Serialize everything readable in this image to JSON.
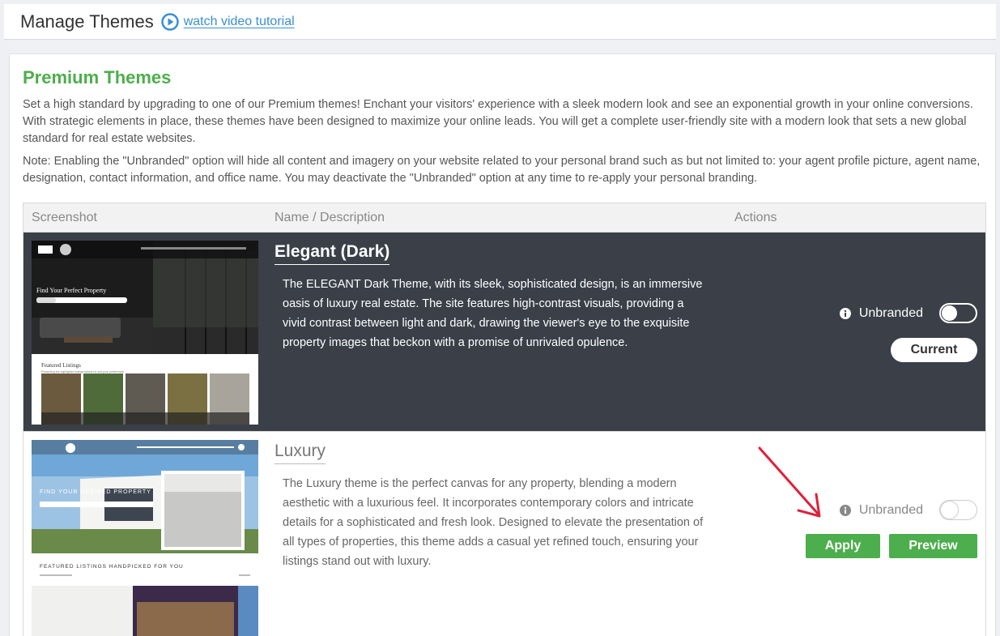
{
  "header": {
    "title": "Manage Themes",
    "tutorial_link": "watch video tutorial"
  },
  "section": {
    "title": "Premium Themes",
    "intro": "Set a high standard by upgrading to one of our Premium themes! Enchant your visitors' experience with a sleek modern look and see an exponential growth in your online conversions. With strategic elements in place, these themes have been designed to maximize your online leads. You will get a complete user-friendly site with a modern look that sets a new global standard for real estate websites.",
    "note": "Note: Enabling the \"Unbranded\" option will hide all content and imagery on your website related to your personal brand such as but not limited to: your agent profile picture, agent name, designation, contact information, and office name. You may deactivate the \"Unbranded\" option at any time to re-apply your personal branding."
  },
  "table": {
    "columns": [
      "Screenshot",
      "Name / Description",
      "Actions"
    ]
  },
  "themes": [
    {
      "name": "Elegant (Dark)",
      "description": "The ELEGANT Dark Theme, with its sleek, sophisticated design, is an immersive oasis of luxury real estate. The site features high-contrast visuals, providing a vivid contrast between light and dark, drawing the viewer's eye to the exquisite property images that beckon with a promise of unrivaled opulence.",
      "unbranded_label": "Unbranded",
      "unbranded_on": false,
      "button": "Current",
      "thumb_hero": "Find Your Perfect Property",
      "thumb_section": "Featured Listings",
      "thumb_sub": "Presenting the highlighted listings tailored to suit your preferences"
    },
    {
      "name": "Luxury",
      "description": "The Luxury theme is the perfect canvas for any property, blending a modern aesthetic with a luxurious feel. It incorporates contemporary colors and intricate details for a sophisticated and fresh look. Designed to elevate the presentation of all types of properties, this theme adds a casual yet refined touch, ensuring your listings stand out with luxury.",
      "unbranded_label": "Unbranded",
      "unbranded_on": false,
      "apply_button": "Apply",
      "preview_button": "Preview",
      "thumb_hero": "FIND YOUR DESIRED PROPERTY",
      "thumb_section": "FEATURED LISTINGS HANDPICKED FOR YOU"
    }
  ],
  "colors": {
    "accent_green": "#4cae4c",
    "link_blue": "#3a8fd1",
    "dark_row": "#3a3f48",
    "annotation_red": "#e0203a"
  }
}
